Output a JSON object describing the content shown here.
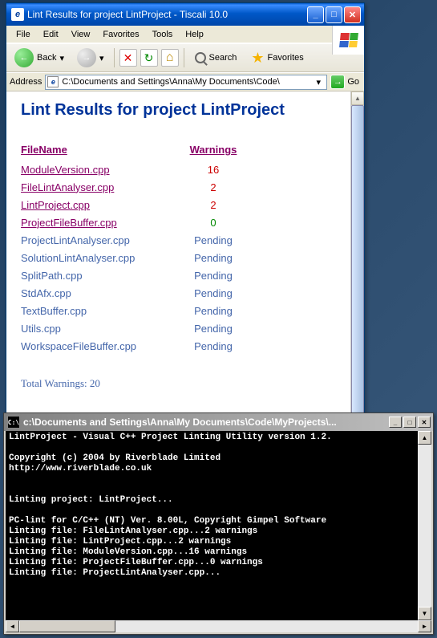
{
  "browser": {
    "title": "Lint Results for project LintProject - Tiscali 10.0",
    "menu": {
      "file": "File",
      "edit": "Edit",
      "view": "View",
      "favorites": "Favorites",
      "tools": "Tools",
      "help": "Help"
    },
    "toolbar": {
      "back": "Back",
      "search": "Search",
      "favorites": "Favorites"
    },
    "address_label": "Address",
    "address_value": "C:\\Documents and Settings\\Anna\\My Documents\\Code\\",
    "go_label": "Go"
  },
  "page": {
    "heading": "Lint Results for project LintProject",
    "col_filename": "FileName",
    "col_warnings": "Warnings",
    "rows": [
      {
        "file": "ModuleVersion.cpp",
        "count": "16",
        "link": true,
        "cls": "warn"
      },
      {
        "file": "FileLintAnalyser.cpp",
        "count": "2",
        "link": true,
        "cls": "warn"
      },
      {
        "file": "LintProject.cpp",
        "count": "2",
        "link": true,
        "cls": "warn"
      },
      {
        "file": "ProjectFileBuffer.cpp",
        "count": "0",
        "link": true,
        "cls": "ok"
      },
      {
        "file": "ProjectLintAnalyser.cpp",
        "count": "Pending",
        "link": false,
        "cls": ""
      },
      {
        "file": "SolutionLintAnalyser.cpp",
        "count": "Pending",
        "link": false,
        "cls": ""
      },
      {
        "file": "SplitPath.cpp",
        "count": "Pending",
        "link": false,
        "cls": ""
      },
      {
        "file": "StdAfx.cpp",
        "count": "Pending",
        "link": false,
        "cls": ""
      },
      {
        "file": "TextBuffer.cpp",
        "count": "Pending",
        "link": false,
        "cls": ""
      },
      {
        "file": "Utils.cpp",
        "count": "Pending",
        "link": false,
        "cls": ""
      },
      {
        "file": "WorkspaceFileBuffer.cpp",
        "count": "Pending",
        "link": false,
        "cls": ""
      }
    ],
    "totals": "Total Warnings: 20"
  },
  "console": {
    "title": "c:\\Documents and Settings\\Anna\\My Documents\\Code\\MyProjects\\...",
    "lines": [
      {
        "t": "LintProject - Visual C++ Project Linting Utility version 1.2.",
        "b": true
      },
      {
        "t": "",
        "b": false
      },
      {
        "t": "Copyright (c) 2004 by Riverblade Limited",
        "b": true
      },
      {
        "t": "http://www.riverblade.co.uk",
        "b": true
      },
      {
        "t": "",
        "b": false
      },
      {
        "t": "",
        "b": false
      },
      {
        "t": "Linting project: LintProject...",
        "b": true
      },
      {
        "t": "",
        "b": false
      },
      {
        "t": "PC-lint for C/C++ (NT) Ver. 8.00L, Copyright Gimpel Software",
        "b": true
      },
      {
        "t": "Linting file: FileLintAnalyser.cpp...2 warnings",
        "b": true
      },
      {
        "t": "Linting file: LintProject.cpp...2 warnings",
        "b": true
      },
      {
        "t": "Linting file: ModuleVersion.cpp...16 warnings",
        "b": true
      },
      {
        "t": "Linting file: ProjectFileBuffer.cpp...0 warnings",
        "b": true
      },
      {
        "t": "Linting file: ProjectLintAnalyser.cpp...",
        "b": true
      }
    ]
  }
}
